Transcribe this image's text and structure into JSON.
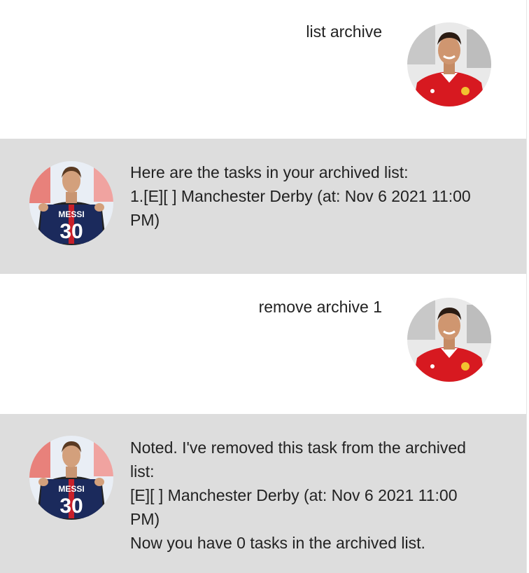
{
  "messages": [
    {
      "role": "user",
      "text": "list archive",
      "avatar": "ronaldo-avatar"
    },
    {
      "role": "bot",
      "text": "Here are the tasks in your archived list:\n1.[E][ ] Manchester Derby (at: Nov 6 2021 11:00\nPM)",
      "avatar": "messi-avatar"
    },
    {
      "role": "user",
      "text": "remove archive 1",
      "avatar": "ronaldo-avatar"
    },
    {
      "role": "bot",
      "text": "Noted. I've removed this task from the archived\nlist:\n[E][ ] Manchester Derby (at: Nov 6 2021 11:00\nPM)\nNow you have 0 tasks in the archived list.",
      "avatar": "messi-avatar"
    }
  ],
  "avatar_text": {
    "messi_name": "MESSI",
    "messi_number": "30"
  },
  "colors": {
    "bot_background": "#dddddd",
    "user_background": "#ffffff",
    "ronaldo_shirt": "#d71920",
    "messi_shirt": "#1b2a5c"
  }
}
